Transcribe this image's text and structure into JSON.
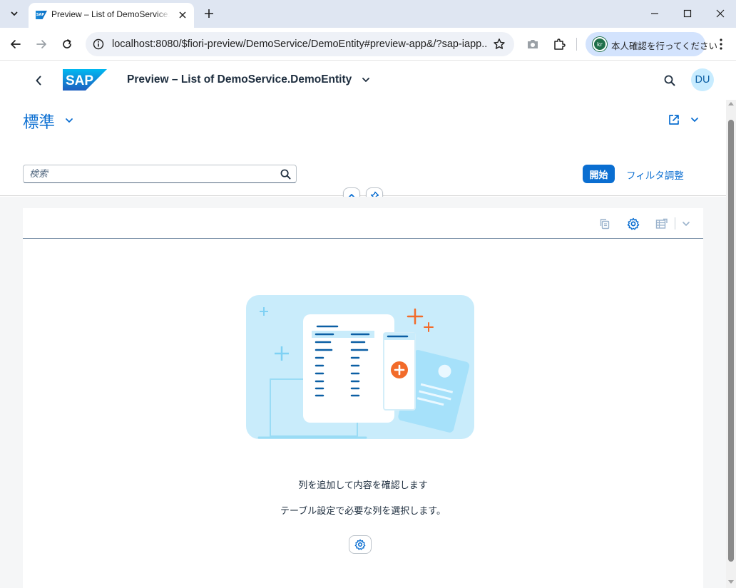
{
  "browser": {
    "tab_title": "Preview – List of DemoService.DemoEntity",
    "url": "localhost:8080/$fiori-preview/DemoService/DemoEntity#preview-app&/?sap-iapp...",
    "profile_text": "本人確認を行ってください",
    "profile_initials": "kr"
  },
  "shell": {
    "logo_text": "SAP",
    "title": "Preview – List of DemoService.DemoEntity",
    "avatar_initials": "DU"
  },
  "header": {
    "variant_name": "標準",
    "search_placeholder": "検索",
    "go_label": "開始",
    "adapt_filters_label": "フィルタ調整"
  },
  "empty_state": {
    "title": "列を追加して内容を確認します",
    "subtitle": "テーブル設定で必要な列を選択します。"
  },
  "colors": {
    "brand_blue": "#0a6ed1",
    "illustration_bg": "#c9ecfb",
    "accent_orange": "#f26b2a"
  }
}
